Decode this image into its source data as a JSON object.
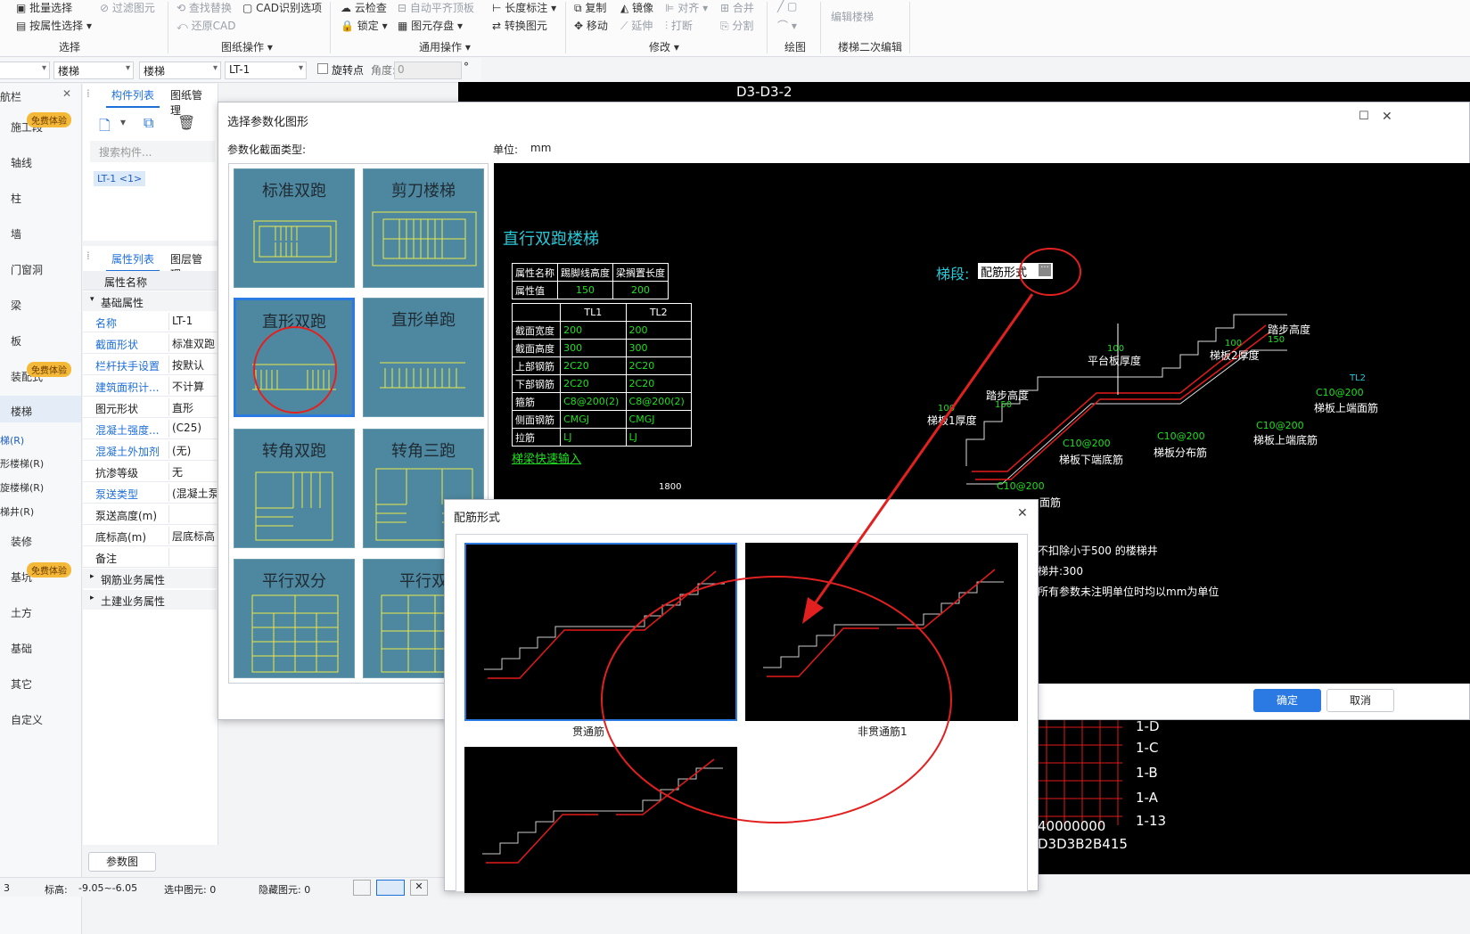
{
  "ribbon": {
    "batch_select": "批量选择",
    "filter_elem": "过滤图元",
    "select_by_attr": "按属性选择",
    "find_replace": "查找替换",
    "restore_cad": "还原CAD",
    "cad_identify": "CAD识别选项",
    "cloud_check": "云检查",
    "auto_level": "自动平齐顶板",
    "lock": "锁定",
    "save_elem": "图元存盘",
    "length_mark": "长度标注",
    "convert_elem": "转换图元",
    "copy": "复制",
    "mirror": "镜像",
    "align": "对齐",
    "merge": "合并",
    "move": "移动",
    "extend": "延伸",
    "break": "打断",
    "split": "分割",
    "edit_stair": "编辑楼梯",
    "g_select": "选择",
    "g_drawing_ops": "图纸操作",
    "g_general_ops": "通用操作",
    "g_modify": "修改",
    "g_draw": "绘图",
    "g_stair_edit": "楼梯二次编辑"
  },
  "toolbar2": {
    "combo1": "楼梯",
    "combo2": "楼梯",
    "combo3": "LT-1",
    "rotate_label": "旋转点",
    "angle_label": "角度:",
    "angle_value": "0",
    "degree": "°"
  },
  "nav": {
    "title": "航栏",
    "badge": "免费体验",
    "items": [
      "施工段",
      "轴线",
      "柱",
      "墙",
      "门窗洞",
      "梁",
      "板",
      "装配式",
      "楼梯",
      "装修",
      "基坑",
      "土方",
      "基础",
      "其它",
      "自定义"
    ],
    "subs": [
      "梯(R)",
      "形楼梯(R)",
      "旋楼梯(R)",
      "梯井(R)"
    ]
  },
  "comp": {
    "tab1": "构件列表",
    "tab2": "图纸管理",
    "search_placeholder": "搜索构件...",
    "item": "LT-1 <1>"
  },
  "props": {
    "tab1": "属性列表",
    "tab2": "图层管理",
    "header": "属性名称",
    "group_basic": "基础属性",
    "rows": [
      [
        "名称",
        "LT-1"
      ],
      [
        "截面形状",
        "标准双跑"
      ],
      [
        "栏杆扶手设置",
        "按默认"
      ],
      [
        "建筑面积计...",
        "不计算"
      ],
      [
        "图元形状",
        "直形"
      ],
      [
        "混凝土强度...",
        "(C25)"
      ],
      [
        "混凝土外加剂",
        "(无)"
      ],
      [
        "抗渗等级",
        "无"
      ],
      [
        "泵送类型",
        "(混凝土泵"
      ],
      [
        "泵送高度(m)",
        ""
      ],
      [
        "底标高(m)",
        "层底标高"
      ],
      [
        "备注",
        ""
      ]
    ],
    "group_rebar": "钢筋业务属性",
    "group_civil": "土建业务属性",
    "param_btn": "参数图"
  },
  "status": {
    "a": "3",
    "b": "标高:",
    "c": "-9.05~-6.05",
    "d": "选中图元: 0",
    "e": "隐藏图元: 0"
  },
  "cad_bg": {
    "top_label": "D3-D3-2",
    "right_labels": [
      "1-D",
      "1-C",
      "1-B",
      "1-A",
      "1-13"
    ],
    "bottom_labels": [
      "40000000",
      "D3D3B2B415"
    ]
  },
  "dialog": {
    "title": "选择参数化图形",
    "section_label": "参数化截面类型:",
    "unit_label": "单位:",
    "unit": "mm",
    "thumbs": [
      "标准双跑",
      "剪刀楼梯",
      "直形双跑",
      "直形单跑",
      "转角双跑",
      "转角三跑",
      "平行双分",
      "平行双"
    ],
    "ok": "确定",
    "cancel": "取消"
  },
  "preview": {
    "title": "直行双跑楼梯",
    "seg_label": "梯段:",
    "seg_value": "配筋形式",
    "attr_table": {
      "h": [
        "属性名称",
        "踢脚线高度",
        "梁搁置长度"
      ],
      "r": [
        "属性值",
        "150",
        "200"
      ]
    },
    "beam_table": {
      "h": [
        "",
        "TL1",
        "TL2"
      ],
      "rows": [
        [
          "截面宽度",
          "200",
          "200"
        ],
        [
          "截面高度",
          "300",
          "300"
        ],
        [
          "上部钢筋",
          "2C20",
          "2C20"
        ],
        [
          "下部钢筋",
          "2C20",
          "2C20"
        ],
        [
          "箍筋",
          "C8@200(2)",
          "C8@200(2)"
        ],
        [
          "侧面钢筋",
          "CMGJ",
          "CMGJ"
        ],
        [
          "拉筋",
          "LJ",
          "LJ"
        ]
      ]
    },
    "quick_input": "梯梁快速输入",
    "labels": {
      "step_height": "踏步高度",
      "landing_thk": "平台板厚度",
      "board2": "梯板2厚度",
      "step_height2": "踏步高度",
      "board1": "梯板1厚度",
      "c10_1": "C10@200",
      "c10_2": "C10@200",
      "c10_3": "C10@200",
      "c10_4": "C10@200",
      "c10_5": "C10@200",
      "top_bottom": "梯板上端底筋",
      "top_face": "梯板上端面筋",
      "low_bottom": "梯板下端底筋",
      "dist": "梯板分布筋",
      "face": "面筋",
      "tl2": "TL2",
      "n100a": "100",
      "n100b": "100",
      "n100c": "100",
      "n150a": "150",
      "n150b": "150",
      "n1800": "1800"
    },
    "notes": [
      "不扣除小于500 的楼梯井",
      "梯井:300",
      "所有参数未注明单位时均以mm为单位"
    ]
  },
  "sub": {
    "title": "配筋形式",
    "options": [
      "贯通筋",
      "非贯通筋1",
      ""
    ]
  }
}
